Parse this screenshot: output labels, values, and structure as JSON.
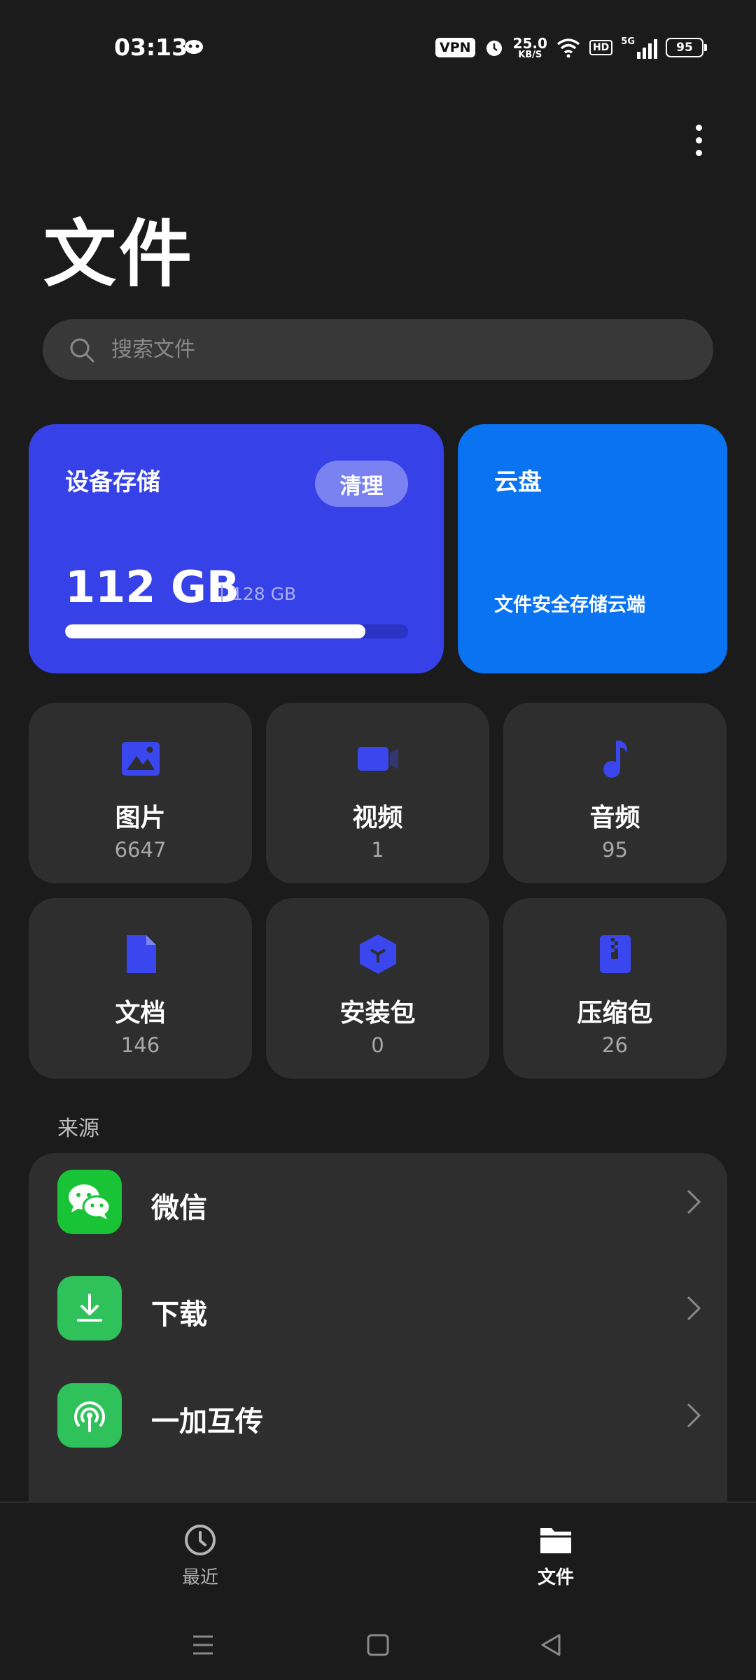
{
  "status_bar": {
    "time": "03:13",
    "vpn": "VPN",
    "speed_value": "25.0",
    "speed_unit": "KB/S",
    "hd": "HD",
    "network": "5G",
    "battery": "95",
    "icons": [
      "alarm-icon",
      "wifi-icon",
      "signal-icon",
      "battery-icon"
    ]
  },
  "header": {
    "title": "文件"
  },
  "search": {
    "placeholder": "搜索文件"
  },
  "storage": {
    "title": "设备存储",
    "clean_label": "清理",
    "used": "112 GB",
    "separator": "|",
    "total": "128 GB",
    "used_fraction": 0.875
  },
  "cloud": {
    "title": "云盘",
    "subtitle": "文件安全存储云端"
  },
  "categories": [
    {
      "label": "图片",
      "count": "6647",
      "icon": "image-icon"
    },
    {
      "label": "视频",
      "count": "1",
      "icon": "video-icon"
    },
    {
      "label": "音频",
      "count": "95",
      "icon": "music-icon"
    },
    {
      "label": "文档",
      "count": "146",
      "icon": "document-icon"
    },
    {
      "label": "安装包",
      "count": "0",
      "icon": "package-icon"
    },
    {
      "label": "压缩包",
      "count": "26",
      "icon": "zip-icon"
    }
  ],
  "sources": {
    "title": "来源",
    "items": [
      {
        "label": "微信",
        "icon": "wechat-icon"
      },
      {
        "label": "下载",
        "icon": "download-icon"
      },
      {
        "label": "一加互传",
        "icon": "share-icon"
      }
    ]
  },
  "bottom_nav": {
    "items": [
      {
        "label": "最近",
        "icon": "clock-icon"
      },
      {
        "label": "文件",
        "icon": "folder-icon"
      }
    ],
    "active": "文件"
  },
  "colors": {
    "background": "#1b1b1b",
    "storage_card": "#3641e7",
    "cloud_card": "#0a73f2",
    "tile": "#2e2e2e",
    "icon_accent": "#3a47ee",
    "source_green": "#2fc25b"
  }
}
